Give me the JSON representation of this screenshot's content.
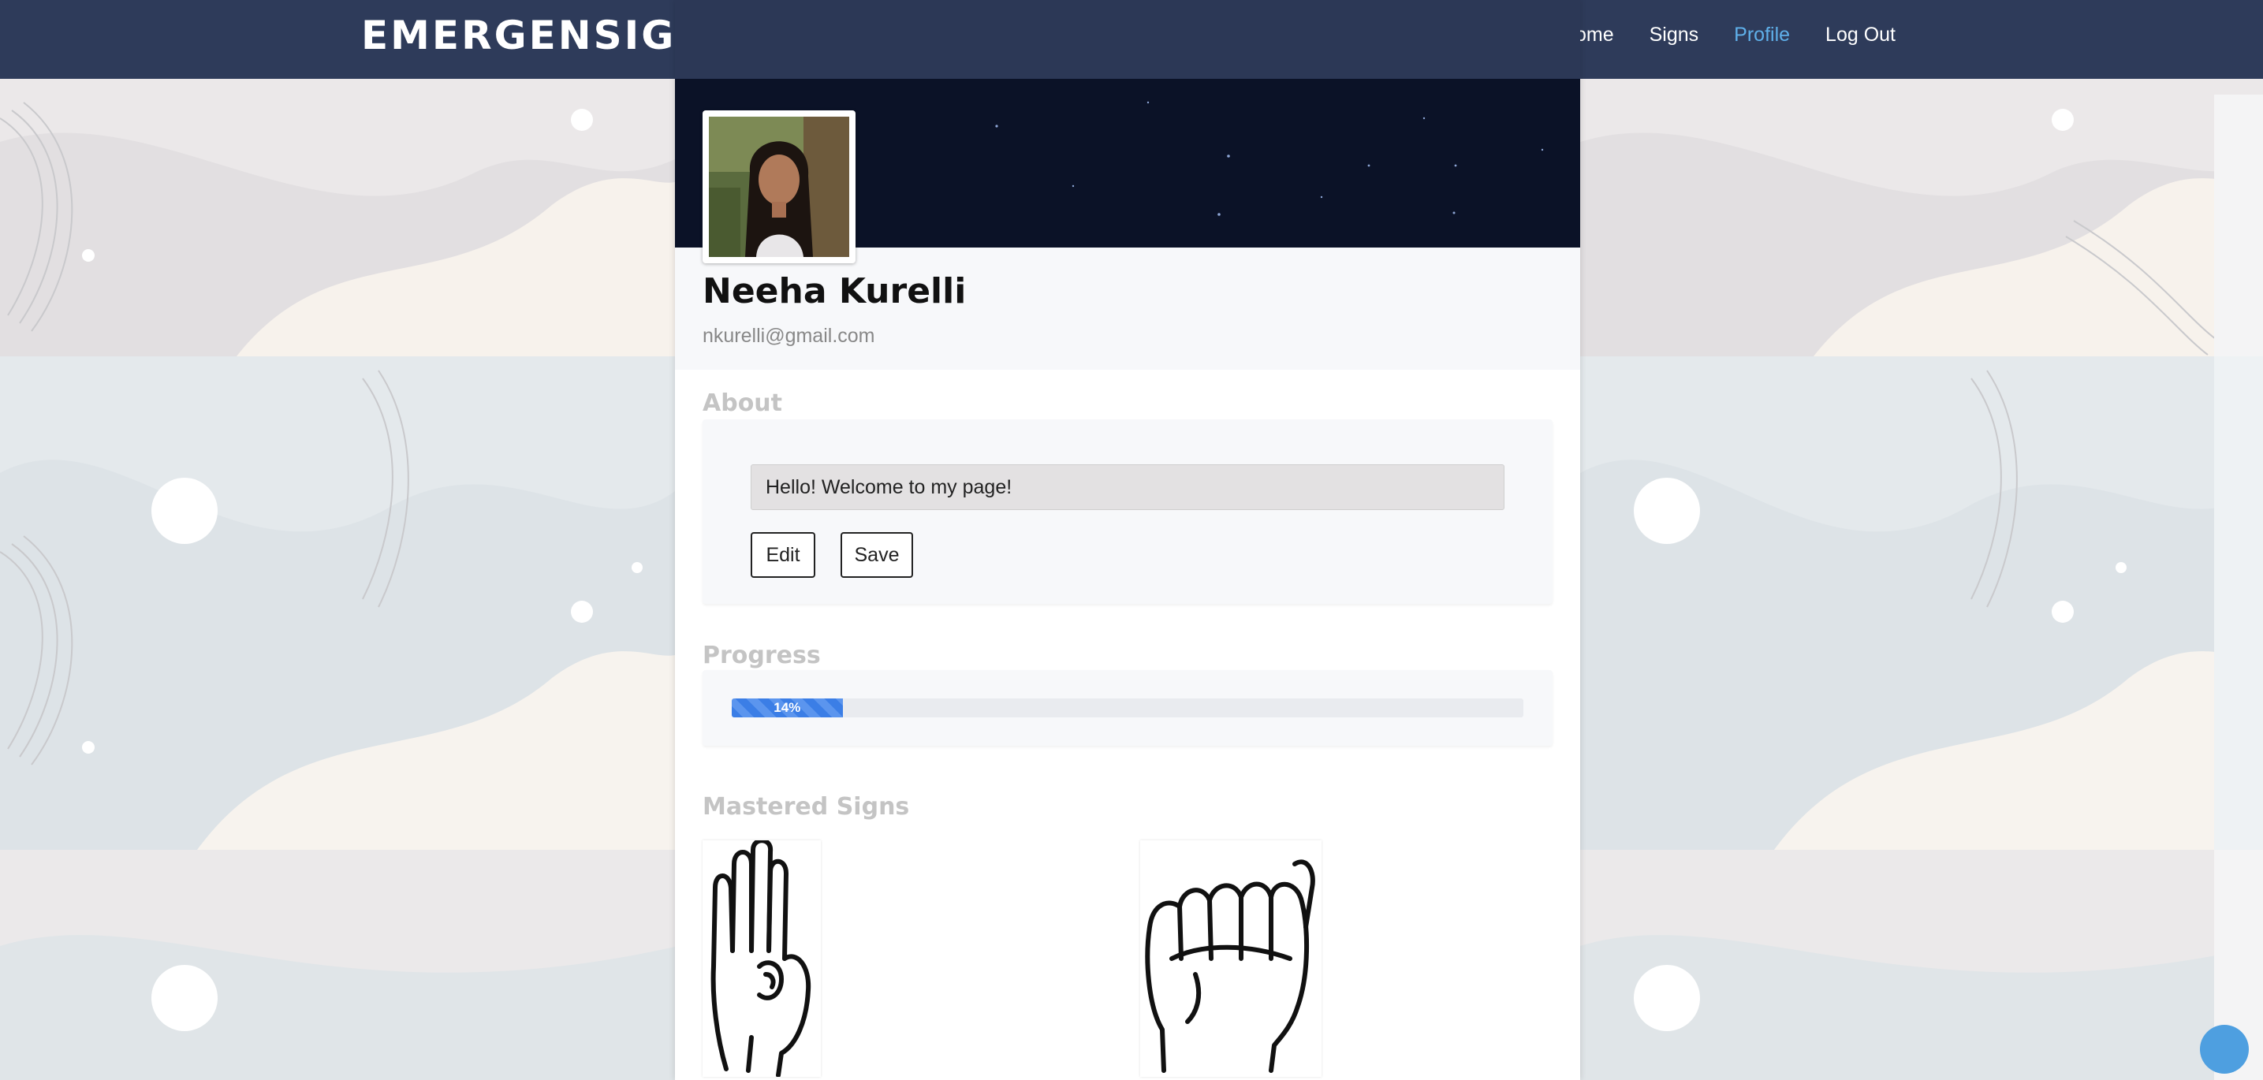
{
  "nav": {
    "brand": "EMERGENSIGNS",
    "links": [
      "Home",
      "Signs",
      "Profile",
      "Log Out"
    ],
    "active": "Profile"
  },
  "profile": {
    "name": "Neeha Kurelli",
    "email": "nkurelli@gmail.com"
  },
  "about": {
    "title": "About",
    "text": "Hello! Welcome to my page!",
    "edit_label": "Edit",
    "save_label": "Save"
  },
  "progress": {
    "title": "Progress",
    "label": "14%",
    "value": 0.14
  },
  "mastered": {
    "title": "Mastered Signs",
    "signs": [
      {
        "icon": "asl-letter-b-hand-icon"
      },
      {
        "icon": "asl-letter-a-hand-icon"
      }
    ]
  },
  "colors": {
    "nav_bg": "#2e3b5a",
    "active_link": "#5fb0ea",
    "progress": "#3b7ee6",
    "banner": "#0b1227",
    "chat": "#4e9fe0"
  }
}
